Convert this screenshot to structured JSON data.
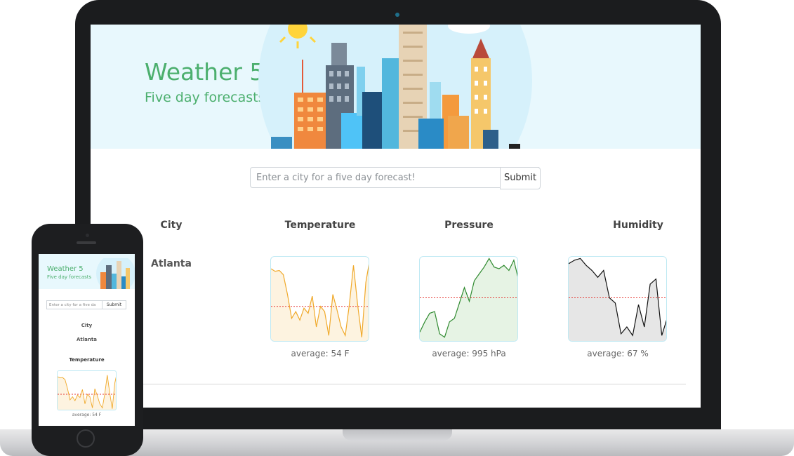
{
  "app": {
    "title": "Weather 5",
    "subtitle": "Five day forecasts"
  },
  "search": {
    "placeholder": "Enter a city for a five day forecast!",
    "placeholder_truncated": "Enter a city for a five da",
    "submit_label": "Submit"
  },
  "table": {
    "headers": [
      "City",
      "Temperature",
      "Pressure",
      "Humidity"
    ],
    "city": "Atlanta",
    "averages": {
      "temperature": "average: 54 F",
      "pressure": "average: 995 hPa",
      "humidity": "average: 67 %"
    }
  },
  "colors": {
    "brand_green": "#4caf6e",
    "temperature_line": "#f0a92a",
    "temperature_fill": "#fdf3e0",
    "pressure_line": "#2f8a2f",
    "pressure_fill": "#e6f3e4",
    "humidity_line": "#111111",
    "humidity_fill": "#e6e6e6",
    "average_line": "#e53935"
  },
  "sparklines": {
    "temperature": [
      14,
      17,
      16,
      21,
      44,
      72,
      64,
      74,
      60,
      66,
      46,
      82,
      58,
      64,
      92,
      44,
      62,
      82,
      92,
      56,
      10,
      56,
      94,
      30,
      2
    ],
    "pressure": [
      88,
      76,
      66,
      64,
      90,
      94,
      76,
      72,
      54,
      36,
      52,
      28,
      20,
      12,
      2,
      12,
      14,
      10,
      16,
      4,
      28
    ],
    "humidity": [
      8,
      4,
      2,
      10,
      16,
      24,
      16,
      48,
      54,
      90,
      82,
      92,
      56,
      82,
      32,
      26,
      92,
      70
    ],
    "average_fraction": {
      "temperature": 0.58,
      "pressure": 0.48,
      "humidity": 0.48
    }
  },
  "phone": {
    "city_header": "City",
    "city": "Atlanta",
    "temperature_header": "Temperature",
    "temperature_avg": "average: 54 F"
  }
}
